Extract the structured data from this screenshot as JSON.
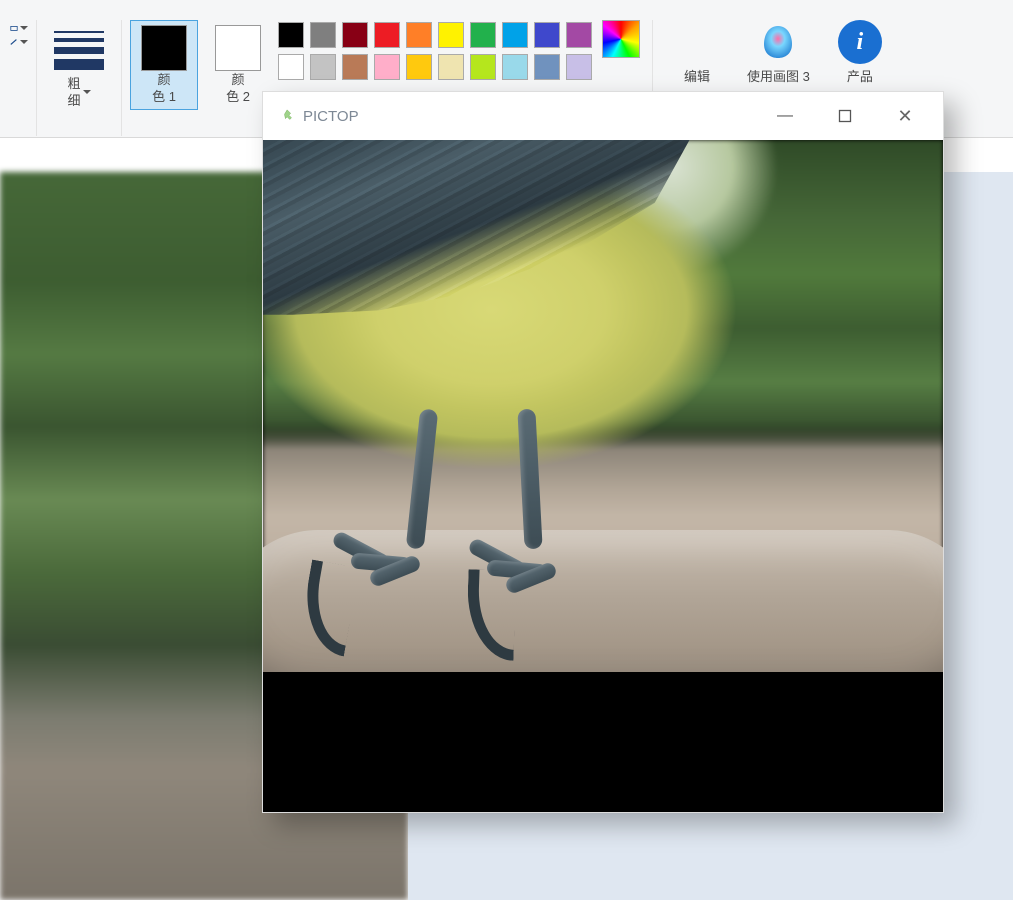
{
  "main_close": "✕",
  "ribbon": {
    "stroke_label": "粗\n细",
    "color1_label": "颜\n色 1",
    "color2_label": "颜\n色 2",
    "edit_label": "编辑",
    "use_paint_label": "使用画图 3",
    "product_label": "产品",
    "palette_row1": [
      "#000000",
      "#7f7f7f",
      "#880015",
      "#ed1c24",
      "#ff7f27",
      "#fff200",
      "#22b14c",
      "#00a2e8",
      "#3f48cc",
      "#a349a4"
    ],
    "palette_row2": [
      "#ffffff",
      "#c3c3c3",
      "#b97a57",
      "#ffaec9",
      "#ffc90e",
      "#efe4b0",
      "#b5e61d",
      "#99d9ea",
      "#7092be",
      "#c8bfe7"
    ]
  },
  "pictop": {
    "title": "PICTOP"
  },
  "icons": {
    "minimize": "—",
    "maximize": "□",
    "close": "✕"
  }
}
